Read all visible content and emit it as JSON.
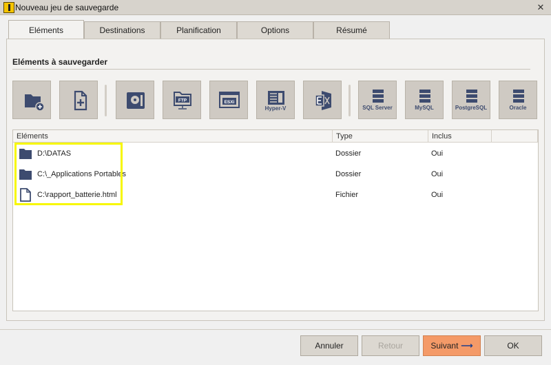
{
  "window": {
    "title": "Nouveau jeu de sauvegarde"
  },
  "tabs": [
    {
      "label": "Eléments",
      "active": true
    },
    {
      "label": "Destinations"
    },
    {
      "label": "Planification"
    },
    {
      "label": "Options"
    },
    {
      "label": "Résumé"
    }
  ],
  "section": {
    "title": "Eléments à sauvegarder"
  },
  "toolbar": {
    "buttons": [
      {
        "name": "add-folder",
        "icon": "folder-plus-icon"
      },
      {
        "name": "add-file",
        "icon": "file-plus-icon"
      },
      {
        "name": "disk-image",
        "icon": "disk-icon"
      },
      {
        "name": "ftp",
        "icon": "ftp-icon",
        "label": "FTP"
      },
      {
        "name": "esxi",
        "icon": "esxi-icon",
        "label": "ESXi"
      },
      {
        "name": "hyper-v",
        "icon": "hyperv-icon",
        "label": "Hyper-V"
      },
      {
        "name": "exchange",
        "icon": "exchange-icon"
      },
      {
        "name": "sql-server",
        "icon": "database-icon",
        "label": "SQL Server"
      },
      {
        "name": "mysql",
        "icon": "database-icon",
        "label": "MySQL"
      },
      {
        "name": "postgresql",
        "icon": "database-icon",
        "label": "PostgreSQL"
      },
      {
        "name": "oracle",
        "icon": "database-icon",
        "label": "Oracle"
      }
    ]
  },
  "list": {
    "columns": [
      "Eléments",
      "Type",
      "Inclus"
    ],
    "rows": [
      {
        "name": "D:\\DATAS",
        "type": "Dossier",
        "included": "Oui",
        "icon": "folder-icon"
      },
      {
        "name": "C:\\_Applications Portables",
        "type": "Dossier",
        "included": "Oui",
        "icon": "folder-icon"
      },
      {
        "name": "C:\\rapport_batterie.html",
        "type": "Fichier",
        "included": "Oui",
        "icon": "file-icon"
      }
    ]
  },
  "footer": {
    "cancel": "Annuler",
    "back": "Retour",
    "next": "Suivant",
    "ok": "OK"
  },
  "colors": {
    "icon": "#3d4b6f",
    "accent": "#f49a68",
    "highlight": "#f7f700"
  }
}
